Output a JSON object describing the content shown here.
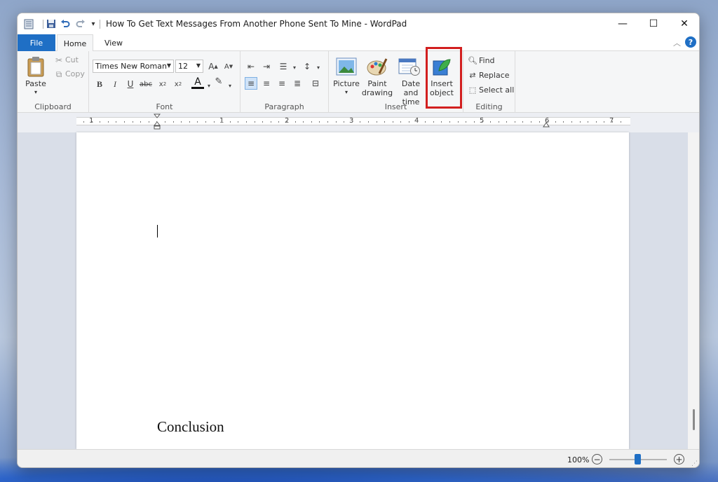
{
  "window": {
    "title": "How To Get Text Messages From Another Phone Sent To Mine - WordPad",
    "controls": {
      "minimize": "—",
      "maximize": "☐",
      "close": "✕"
    }
  },
  "quick_access": {
    "icons": [
      "wordpad-icon",
      "save-icon",
      "undo-icon",
      "redo-icon",
      "customize-dropdown-icon"
    ]
  },
  "tabs": [
    {
      "label": "File"
    },
    {
      "label": "Home"
    },
    {
      "label": "View"
    }
  ],
  "ribbon": {
    "clipboard": {
      "label": "Clipboard",
      "paste": "Paste",
      "cut": "Cut",
      "copy": "Copy"
    },
    "font": {
      "label": "Font",
      "family": "Times New Roman",
      "size": "12"
    },
    "paragraph": {
      "label": "Paragraph"
    },
    "insert": {
      "label": "Insert",
      "picture": "Picture",
      "paint_line1": "Paint",
      "paint_line2": "drawing",
      "date_line1": "Date and",
      "date_line2": "time",
      "object_line1": "Insert",
      "object_line2": "object"
    },
    "editing": {
      "label": "Editing",
      "find": "Find",
      "replace": "Replace",
      "select_all": "Select all"
    }
  },
  "ruler": {
    "numbers": [
      "1",
      "1",
      "2",
      "3",
      "4",
      "5",
      "6",
      "7"
    ]
  },
  "document": {
    "heading": "Conclusion"
  },
  "status": {
    "zoom": "100%",
    "zoom_level_percent": 100
  },
  "colors": {
    "accent": "#1f6fc5",
    "highlight": "#d21f1f"
  }
}
